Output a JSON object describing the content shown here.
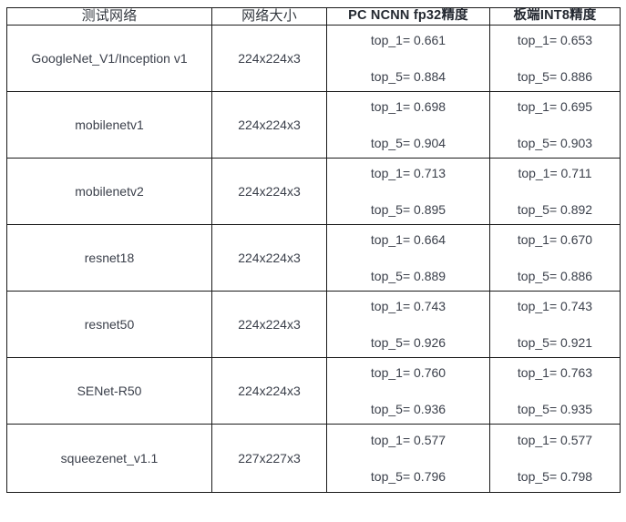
{
  "table": {
    "headers": [
      {
        "label": "测试网络",
        "bold": false
      },
      {
        "label": "网络大小",
        "bold": false
      },
      {
        "label": "PC NCNN fp32精度",
        "bold": true
      },
      {
        "label": "板端INT8精度",
        "bold": true
      }
    ],
    "rows": [
      {
        "network": "GoogleNet_V1/Inception  v1",
        "size": "224x224x3",
        "pc_top1": "top_1= 0.661",
        "pc_top5": "top_5= 0.884",
        "board_top1": "top_1= 0.653",
        "board_top5": "top_5= 0.886"
      },
      {
        "network": "mobilenetv1",
        "size": "224x224x3",
        "pc_top1": "top_1= 0.698",
        "pc_top5": "top_5= 0.904",
        "board_top1": "top_1= 0.695",
        "board_top5": "top_5= 0.903"
      },
      {
        "network": "mobilenetv2",
        "size": "224x224x3",
        "pc_top1": "top_1= 0.713",
        "pc_top5": "top_5= 0.895",
        "board_top1": "top_1= 0.711",
        "board_top5": "top_5= 0.892"
      },
      {
        "network": "resnet18",
        "size": "224x224x3",
        "pc_top1": "top_1= 0.664",
        "pc_top5": "top_5= 0.889",
        "board_top1": "top_1= 0.670",
        "board_top5": "top_5= 0.886"
      },
      {
        "network": "resnet50",
        "size": "224x224x3",
        "pc_top1": "top_1= 0.743",
        "pc_top5": "top_5= 0.926",
        "board_top1": "top_1= 0.743",
        "board_top5": "top_5= 0.921"
      },
      {
        "network": "SENet-R50",
        "size": "224x224x3",
        "pc_top1": "top_1= 0.760",
        "pc_top5": "top_5= 0.936",
        "board_top1": "top_1= 0.763",
        "board_top5": "top_5= 0.935"
      },
      {
        "network": "squeezenet_v1.1",
        "size": "227x227x3",
        "pc_top1": "top_1= 0.577",
        "pc_top5": "top_5= 0.796",
        "board_top1": "top_1= 0.577",
        "board_top5": "top_5= 0.798"
      }
    ]
  },
  "chart_data": {
    "type": "table",
    "title": "",
    "columns": [
      "测试网络",
      "网络大小",
      "PC NCNN fp32精度",
      "板端INT8精度"
    ],
    "rows": [
      [
        "GoogleNet_V1/Inception  v1",
        "224x224x3",
        "top_1= 0.661 / top_5= 0.884",
        "top_1= 0.653 / top_5= 0.886"
      ],
      [
        "mobilenetv1",
        "224x224x3",
        "top_1= 0.698 / top_5= 0.904",
        "top_1= 0.695 / top_5= 0.903"
      ],
      [
        "mobilenetv2",
        "224x224x3",
        "top_1= 0.713 / top_5= 0.895",
        "top_1= 0.711 / top_5= 0.892"
      ],
      [
        "resnet18",
        "224x224x3",
        "top_1= 0.664 / top_5= 0.889",
        "top_1= 0.670 / top_5= 0.886"
      ],
      [
        "resnet50",
        "224x224x3",
        "top_1= 0.743 / top_5= 0.926",
        "top_1= 0.743 / top_5= 0.921"
      ],
      [
        "SENet-R50",
        "224x224x3",
        "top_1= 0.760 / top_5= 0.936",
        "top_1= 0.763 / top_5= 0.935"
      ],
      [
        "squeezenet_v1.1",
        "227x227x3",
        "top_1= 0.577 / top_5= 0.796",
        "top_1= 0.577 / top_5= 0.798"
      ]
    ],
    "series": [
      {
        "name": "PC NCNN fp32 top_1",
        "values": [
          0.661,
          0.698,
          0.713,
          0.664,
          0.743,
          0.76,
          0.577
        ]
      },
      {
        "name": "PC NCNN fp32 top_5",
        "values": [
          0.884,
          0.904,
          0.895,
          0.889,
          0.926,
          0.936,
          0.796
        ]
      },
      {
        "name": "板端INT8 top_1",
        "values": [
          0.653,
          0.695,
          0.711,
          0.67,
          0.743,
          0.763,
          0.577
        ]
      },
      {
        "name": "板端INT8 top_5",
        "values": [
          0.886,
          0.903,
          0.892,
          0.886,
          0.921,
          0.935,
          0.798
        ]
      }
    ],
    "categories": [
      "GoogleNet_V1/Inception v1",
      "mobilenetv1",
      "mobilenetv2",
      "resnet18",
      "resnet50",
      "SENet-R50",
      "squeezenet_v1.1"
    ],
    "xlabel": "",
    "ylabel": "",
    "grid": true,
    "legend": "none"
  }
}
